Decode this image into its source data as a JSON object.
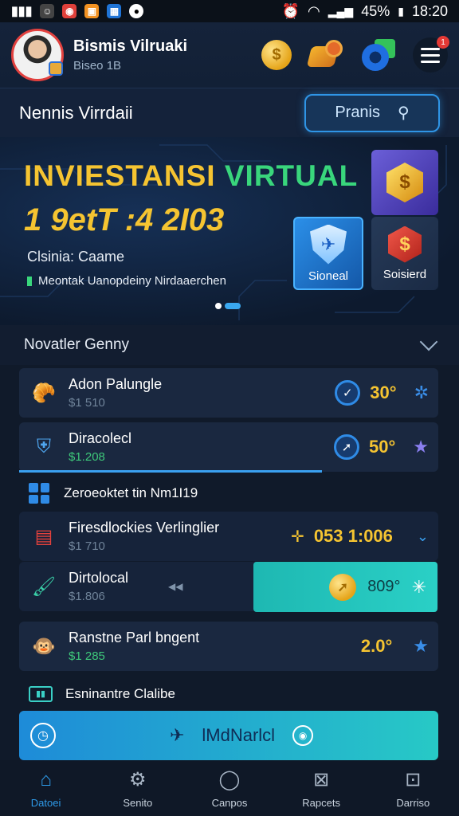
{
  "status": {
    "battery": "45%",
    "time": "18:20"
  },
  "header": {
    "user_name": "Bismis Vilruaki",
    "user_id": "Biseo 1B",
    "badge": "1"
  },
  "titlebar": {
    "title": "Nennis Virrdaii",
    "search_label": "Pranis"
  },
  "banner": {
    "title_part1": "INVIESTANSI",
    "title_part2": "VIRTUAL",
    "number": "1 9etT :4 2I03",
    "subtitle": "Clsinia: Caame",
    "description": "Meontak Uanopdeiny Nirdaaerchen",
    "tiles": [
      {
        "label": "Sioneal"
      },
      {
        "label": "Soisierd"
      }
    ]
  },
  "section": {
    "title": "Novatler Genny"
  },
  "rows": [
    {
      "name": "Adon Palungle",
      "sub": "$1 510",
      "value": "30°"
    },
    {
      "name": "Diracolecl",
      "sub": "$1.208",
      "value": "50°"
    },
    {
      "name": "Zeroeoktet tin Nm1I19"
    },
    {
      "name": "Firesdlockies Verlinglier",
      "sub": "$1 710",
      "value": "053 1:006"
    },
    {
      "name": "Dirtolocal",
      "sub": "$1.806",
      "value": "809°"
    },
    {
      "name": "Ranstne Parl bngent",
      "sub": "$1 285",
      "value": "2.0°"
    },
    {
      "name": "Esninantre Clalibe"
    }
  ],
  "cta": {
    "label": "lMdNarlcl"
  },
  "nav": [
    {
      "label": "Datoei",
      "icon": "home-icon"
    },
    {
      "label": "Senito",
      "icon": "gear-icon"
    },
    {
      "label": "Canpos",
      "icon": "chat-icon"
    },
    {
      "label": "Rapcets",
      "icon": "close-box-icon"
    },
    {
      "label": "Darriso",
      "icon": "inbox-icon"
    }
  ],
  "colors": {
    "accent": "#2e9ae8",
    "gold": "#f5c431",
    "green": "#39d67c",
    "background": "#101a2a"
  }
}
